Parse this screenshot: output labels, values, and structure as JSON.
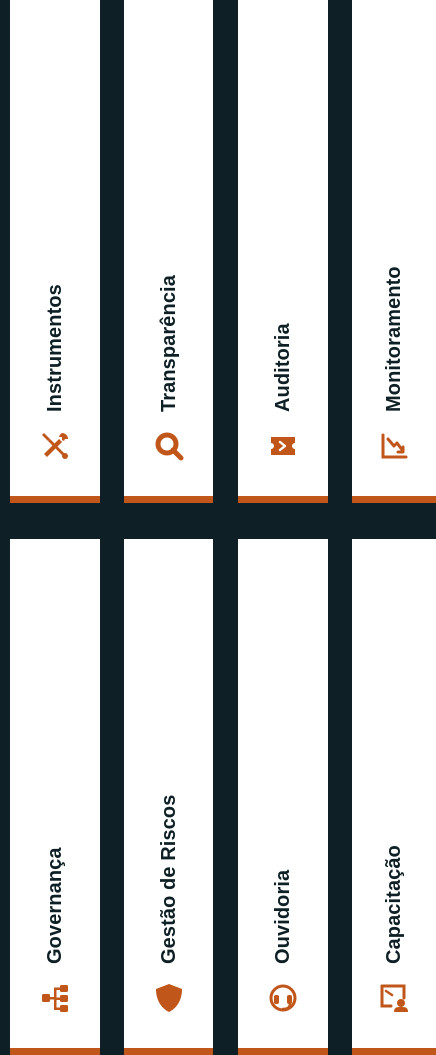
{
  "colors": {
    "background": "#0e2025",
    "card": "#ffffff",
    "accent": "#c0561a",
    "text": "#0e2025"
  },
  "cards": [
    {
      "label": "Instrumentos",
      "icon": "tools-icon"
    },
    {
      "label": "Transparência",
      "icon": "magnifier-icon"
    },
    {
      "label": "Auditoria",
      "icon": "ticket-icon"
    },
    {
      "label": "Monitoramento",
      "icon": "chart-down-icon"
    },
    {
      "label": "Governança",
      "icon": "hierarchy-icon"
    },
    {
      "label": "Gestão de Riscos",
      "icon": "shield-icon"
    },
    {
      "label": "Ouvidoria",
      "icon": "headset-icon"
    },
    {
      "label": "Capacitação",
      "icon": "training-icon"
    }
  ]
}
